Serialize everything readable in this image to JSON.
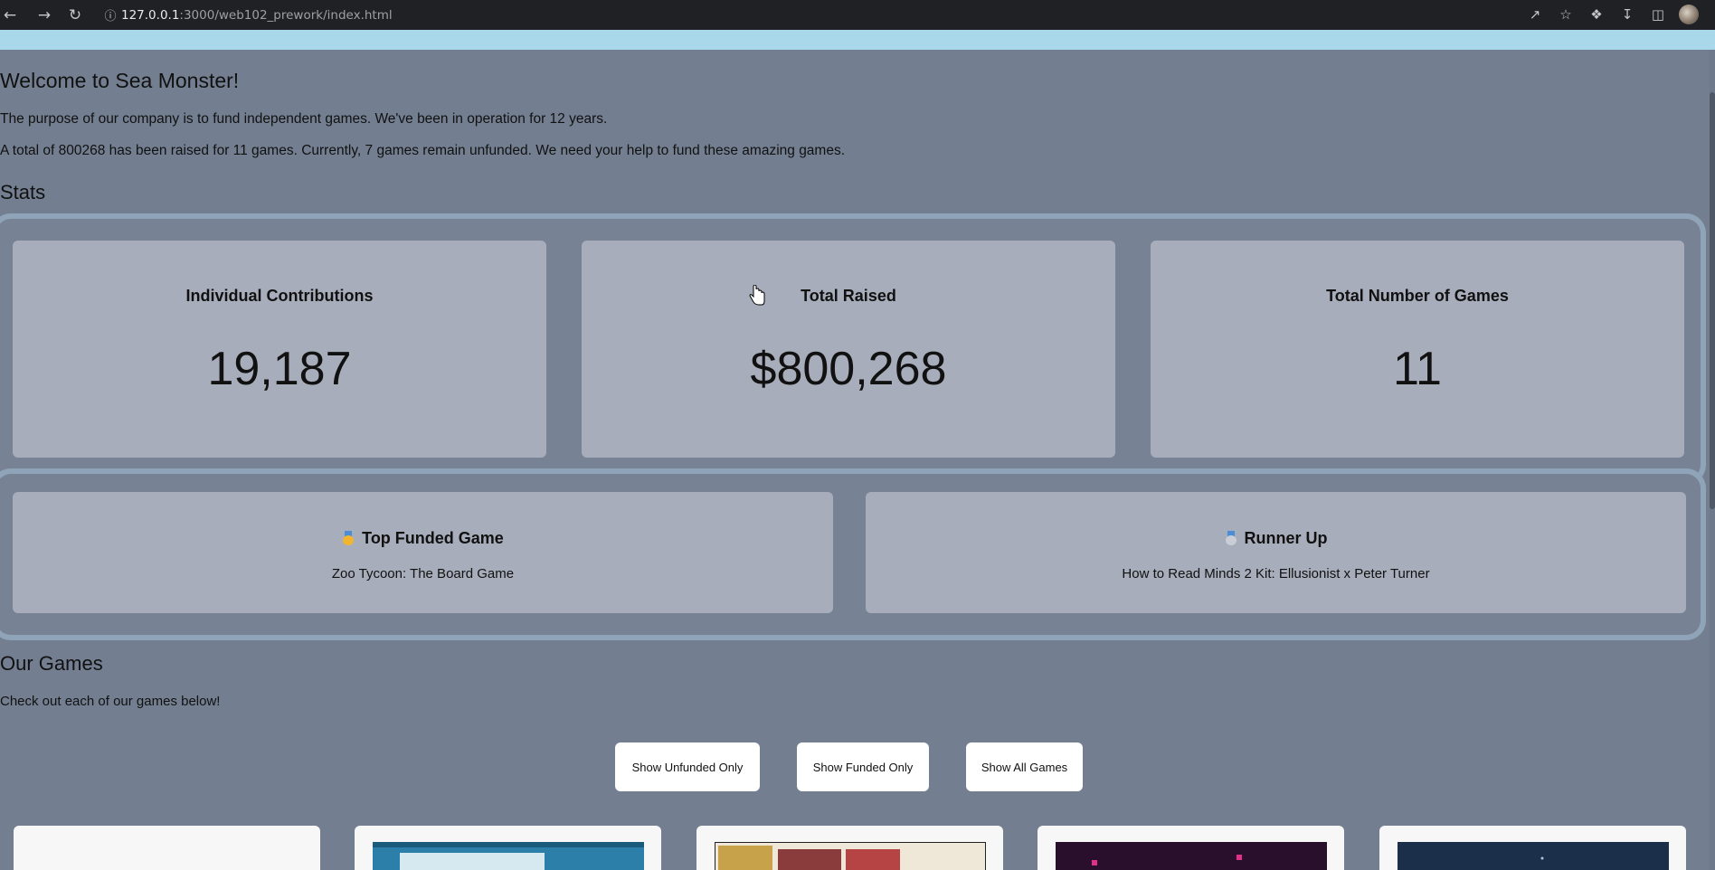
{
  "browser": {
    "url_host": "127.0.0.1",
    "url_path": ":3000/web102_prework/index.html"
  },
  "header": {
    "title": "Welcome to Sea Monster!"
  },
  "intro": {
    "purpose": "The purpose of our company is to fund independent games. We've been in operation for 12 years.",
    "summary": "A total of 800268 has been raised for 11 games. Currently, 7 games remain unfunded. We need your help to fund these amazing games."
  },
  "stats": {
    "heading": "Stats",
    "cards": [
      {
        "label": "Individual Contributions",
        "value": "19,187"
      },
      {
        "label": "Total Raised",
        "value": "$800,268"
      },
      {
        "label": "Total Number of Games",
        "value": "11"
      }
    ]
  },
  "top_games": {
    "first": {
      "heading": "Top Funded Game",
      "name": "Zoo Tycoon: The Board Game",
      "icon": "gold-medal-icon"
    },
    "second": {
      "heading": "Runner Up",
      "name": "How to Read Minds 2 Kit: Ellusionist x Peter Turner",
      "icon": "silver-medal-icon"
    }
  },
  "games": {
    "heading": "Our Games",
    "subtitle": "Check out each of our games below!",
    "buttons": {
      "unfunded": "Show Unfunded Only",
      "funded": "Show Funded Only",
      "all": "Show All Games"
    }
  },
  "colors": {
    "page_bg": "#737f90",
    "card_bg": "#a7adba",
    "accent_strip": "#a8d8ea"
  }
}
